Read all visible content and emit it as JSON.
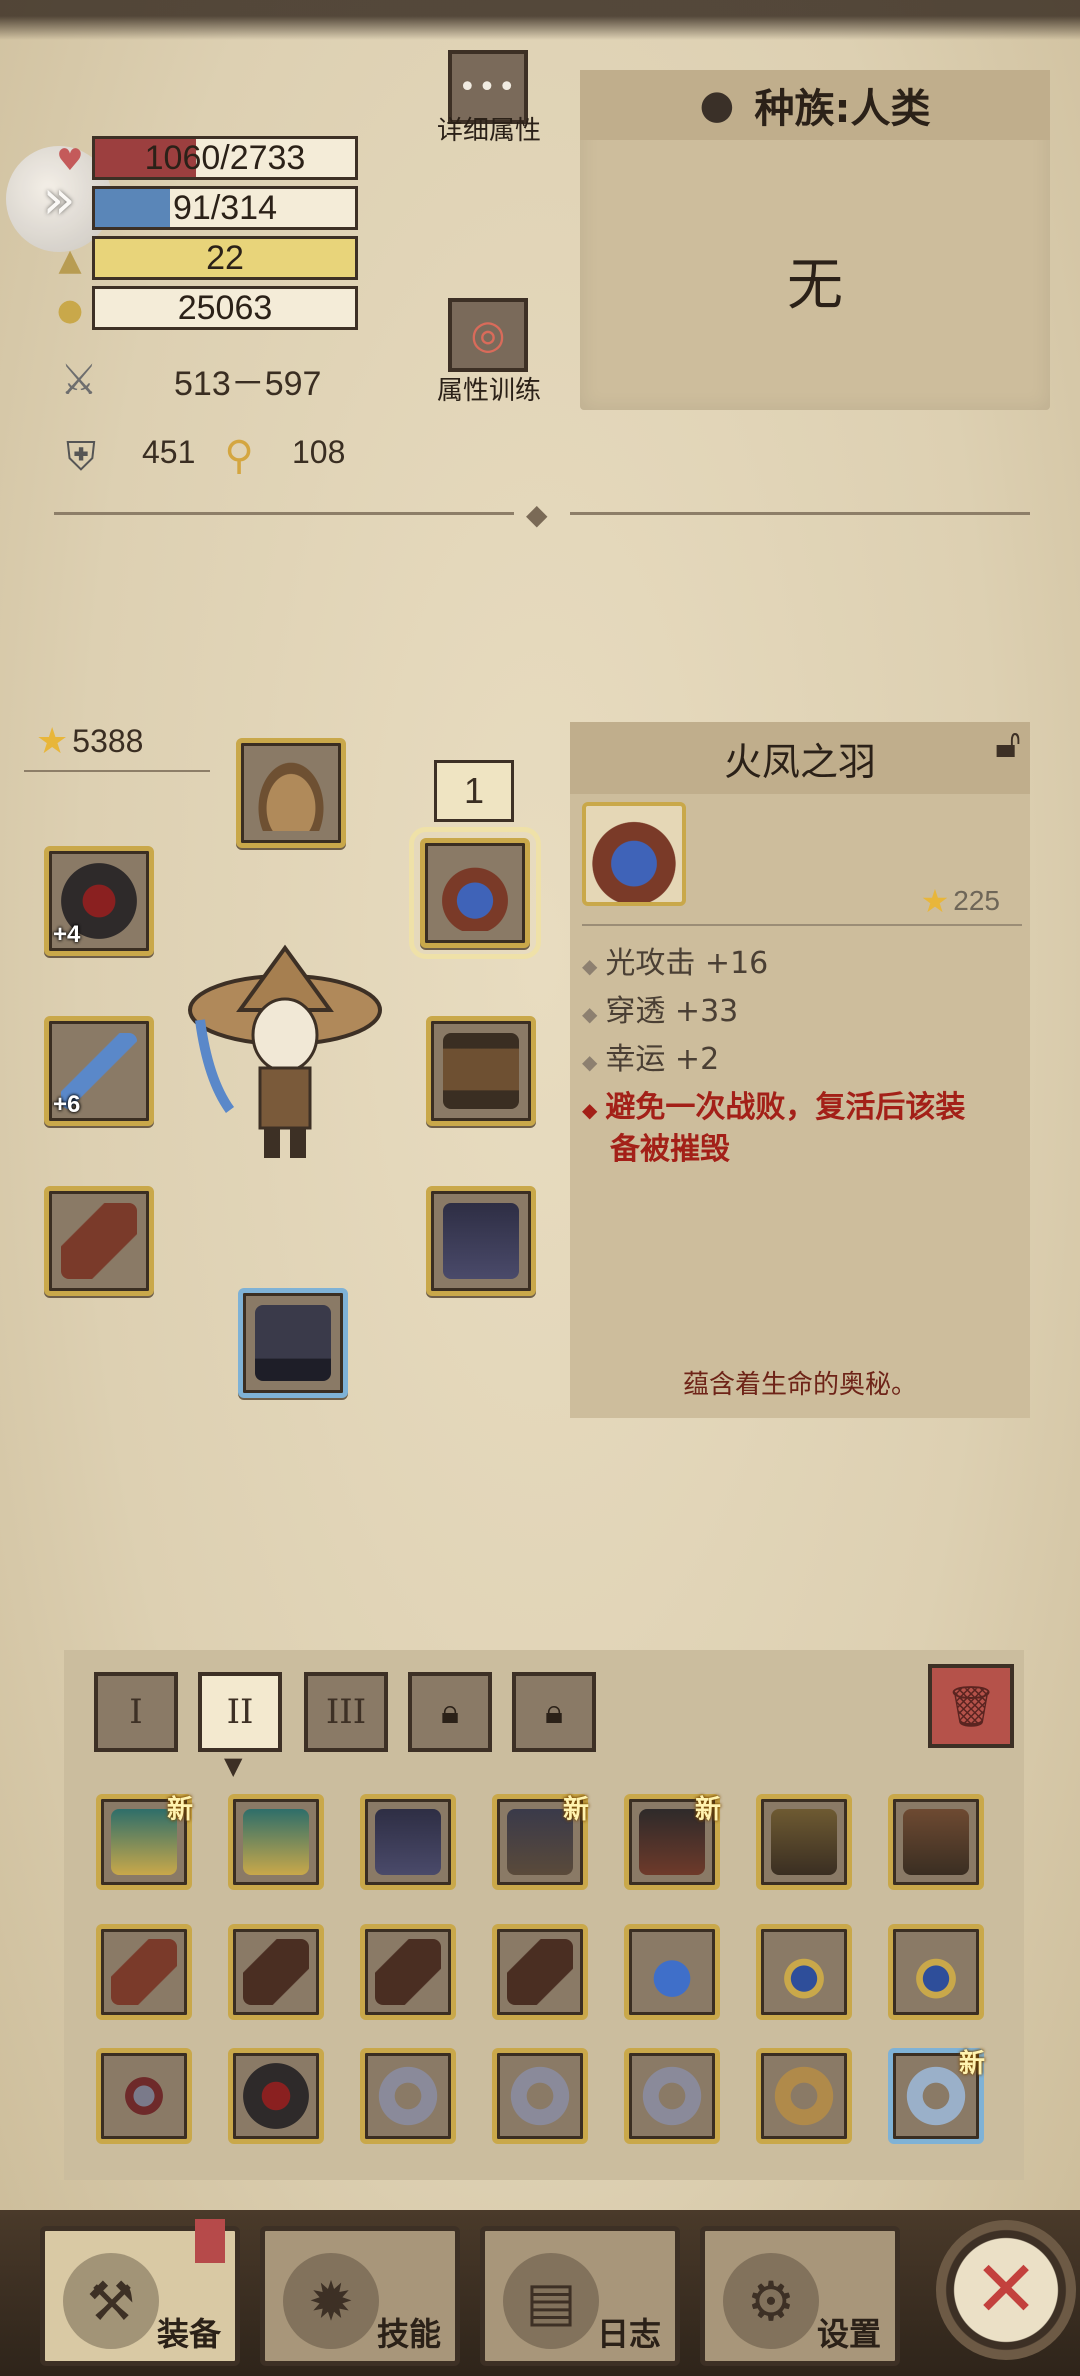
{
  "stats": {
    "hp": "1060/2733",
    "hp_fraction": 0.39,
    "mp": "91/314",
    "mp_fraction": 0.29,
    "level": "22",
    "gold": "25063",
    "attack": "513－597",
    "defense": "451",
    "magic": "108"
  },
  "buttons": {
    "detail_attributes": "详细属性",
    "attribute_training": "属性训练"
  },
  "race": {
    "label": "种族:人类",
    "value": "无"
  },
  "equipment": {
    "power": "5388",
    "set_badge": "1",
    "ring_plus": "+4",
    "weapon_plus": "+6"
  },
  "detail": {
    "title": "火凤之羽",
    "power": "225",
    "attrs": [
      "光攻击 +16",
      "穿透 +33",
      "幸运 +2"
    ],
    "special_line1": "避免一次战败，复活后该装",
    "special_line2": "备被摧毁",
    "flavor": "蕴含着生命的奥秘。"
  },
  "inventory": {
    "tabs": [
      "I",
      "II",
      "III"
    ],
    "new_badge": "新"
  },
  "nav": {
    "equip": "装备",
    "skills": "技能",
    "log": "日志",
    "settings": "设置"
  },
  "colors": {
    "hp": "#9c3f3f",
    "mp": "#5a86b8",
    "level": "#e8d47a",
    "accent_gold": "#c9a84a",
    "accent_red": "#a32018"
  }
}
